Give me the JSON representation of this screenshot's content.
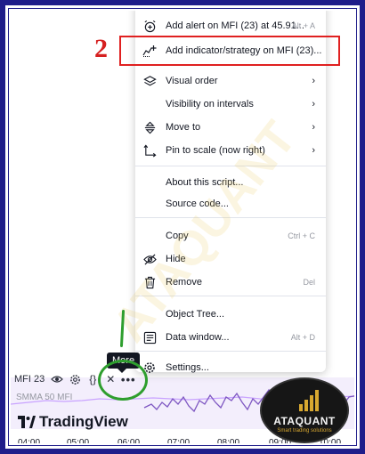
{
  "menu": {
    "items": [
      {
        "label": "Add alert on MFI (23) at 45.91...",
        "shortcut": "Alt + A",
        "icon": "alarm-clock-plus-icon"
      },
      {
        "label": "Add indicator/strategy on MFI (23)...",
        "shortcut": "",
        "icon": "chart-plus-icon"
      },
      {
        "label": "Visual order",
        "shortcut": "",
        "icon": "layers-icon",
        "submenu": true
      },
      {
        "label": "Visibility on intervals",
        "shortcut": "",
        "icon": "",
        "submenu": true
      },
      {
        "label": "Move to",
        "shortcut": "",
        "icon": "move-vertical-icon",
        "submenu": true
      },
      {
        "label": "Pin to scale (now right)",
        "shortcut": "",
        "icon": "pin-scale-icon",
        "submenu": true
      },
      {
        "label": "About this script...",
        "shortcut": "",
        "icon": ""
      },
      {
        "label": "Source code...",
        "shortcut": "",
        "icon": ""
      },
      {
        "label": "Copy",
        "shortcut": "Ctrl + C",
        "icon": ""
      },
      {
        "label": "Hide",
        "shortcut": "",
        "icon": "eye-off-icon"
      },
      {
        "label": "Remove",
        "shortcut": "Del",
        "icon": "trash-icon"
      },
      {
        "label": "Object Tree...",
        "shortcut": "",
        "icon": ""
      },
      {
        "label": "Data window...",
        "shortcut": "Alt + D",
        "icon": "data-window-icon"
      },
      {
        "label": "Settings...",
        "shortcut": "",
        "icon": "gear-icon"
      }
    ]
  },
  "annotation": {
    "step_number": "2"
  },
  "tooltip": {
    "text": "More"
  },
  "legend": {
    "indicator": "MFI 23",
    "more_glyph": "•••",
    "smma_label": "SMMA 50 MFI"
  },
  "brand": {
    "name": "TradingView"
  },
  "time_axis": [
    "04:00",
    "05:00",
    "06:00",
    "07:00",
    "08:00",
    "09:00",
    "10:00"
  ],
  "badge": {
    "name": "ATAQUANT",
    "tagline": "Smart trading solutions"
  },
  "watermark": {
    "text": "ATAQUANT"
  },
  "colors": {
    "frame": "#1f1d8a",
    "highlight": "#e02020",
    "circle": "#2e9e2e",
    "mfi_line": "#7e57c2",
    "smma_line": "#c9a3ff"
  }
}
